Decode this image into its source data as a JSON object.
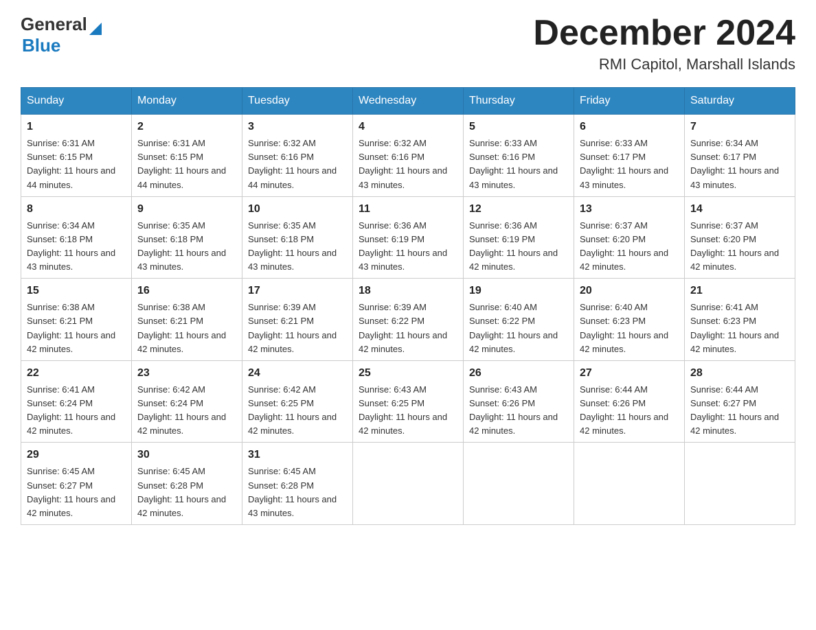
{
  "header": {
    "logo_general": "General",
    "logo_blue": "Blue",
    "month_title": "December 2024",
    "location": "RMI Capitol, Marshall Islands"
  },
  "days_of_week": [
    "Sunday",
    "Monday",
    "Tuesday",
    "Wednesday",
    "Thursday",
    "Friday",
    "Saturday"
  ],
  "weeks": [
    [
      {
        "day": "1",
        "sunrise": "6:31 AM",
        "sunset": "6:15 PM",
        "daylight": "11 hours and 44 minutes."
      },
      {
        "day": "2",
        "sunrise": "6:31 AM",
        "sunset": "6:15 PM",
        "daylight": "11 hours and 44 minutes."
      },
      {
        "day": "3",
        "sunrise": "6:32 AM",
        "sunset": "6:16 PM",
        "daylight": "11 hours and 44 minutes."
      },
      {
        "day": "4",
        "sunrise": "6:32 AM",
        "sunset": "6:16 PM",
        "daylight": "11 hours and 43 minutes."
      },
      {
        "day": "5",
        "sunrise": "6:33 AM",
        "sunset": "6:16 PM",
        "daylight": "11 hours and 43 minutes."
      },
      {
        "day": "6",
        "sunrise": "6:33 AM",
        "sunset": "6:17 PM",
        "daylight": "11 hours and 43 minutes."
      },
      {
        "day": "7",
        "sunrise": "6:34 AM",
        "sunset": "6:17 PM",
        "daylight": "11 hours and 43 minutes."
      }
    ],
    [
      {
        "day": "8",
        "sunrise": "6:34 AM",
        "sunset": "6:18 PM",
        "daylight": "11 hours and 43 minutes."
      },
      {
        "day": "9",
        "sunrise": "6:35 AM",
        "sunset": "6:18 PM",
        "daylight": "11 hours and 43 minutes."
      },
      {
        "day": "10",
        "sunrise": "6:35 AM",
        "sunset": "6:18 PM",
        "daylight": "11 hours and 43 minutes."
      },
      {
        "day": "11",
        "sunrise": "6:36 AM",
        "sunset": "6:19 PM",
        "daylight": "11 hours and 43 minutes."
      },
      {
        "day": "12",
        "sunrise": "6:36 AM",
        "sunset": "6:19 PM",
        "daylight": "11 hours and 42 minutes."
      },
      {
        "day": "13",
        "sunrise": "6:37 AM",
        "sunset": "6:20 PM",
        "daylight": "11 hours and 42 minutes."
      },
      {
        "day": "14",
        "sunrise": "6:37 AM",
        "sunset": "6:20 PM",
        "daylight": "11 hours and 42 minutes."
      }
    ],
    [
      {
        "day": "15",
        "sunrise": "6:38 AM",
        "sunset": "6:21 PM",
        "daylight": "11 hours and 42 minutes."
      },
      {
        "day": "16",
        "sunrise": "6:38 AM",
        "sunset": "6:21 PM",
        "daylight": "11 hours and 42 minutes."
      },
      {
        "day": "17",
        "sunrise": "6:39 AM",
        "sunset": "6:21 PM",
        "daylight": "11 hours and 42 minutes."
      },
      {
        "day": "18",
        "sunrise": "6:39 AM",
        "sunset": "6:22 PM",
        "daylight": "11 hours and 42 minutes."
      },
      {
        "day": "19",
        "sunrise": "6:40 AM",
        "sunset": "6:22 PM",
        "daylight": "11 hours and 42 minutes."
      },
      {
        "day": "20",
        "sunrise": "6:40 AM",
        "sunset": "6:23 PM",
        "daylight": "11 hours and 42 minutes."
      },
      {
        "day": "21",
        "sunrise": "6:41 AM",
        "sunset": "6:23 PM",
        "daylight": "11 hours and 42 minutes."
      }
    ],
    [
      {
        "day": "22",
        "sunrise": "6:41 AM",
        "sunset": "6:24 PM",
        "daylight": "11 hours and 42 minutes."
      },
      {
        "day": "23",
        "sunrise": "6:42 AM",
        "sunset": "6:24 PM",
        "daylight": "11 hours and 42 minutes."
      },
      {
        "day": "24",
        "sunrise": "6:42 AM",
        "sunset": "6:25 PM",
        "daylight": "11 hours and 42 minutes."
      },
      {
        "day": "25",
        "sunrise": "6:43 AM",
        "sunset": "6:25 PM",
        "daylight": "11 hours and 42 minutes."
      },
      {
        "day": "26",
        "sunrise": "6:43 AM",
        "sunset": "6:26 PM",
        "daylight": "11 hours and 42 minutes."
      },
      {
        "day": "27",
        "sunrise": "6:44 AM",
        "sunset": "6:26 PM",
        "daylight": "11 hours and 42 minutes."
      },
      {
        "day": "28",
        "sunrise": "6:44 AM",
        "sunset": "6:27 PM",
        "daylight": "11 hours and 42 minutes."
      }
    ],
    [
      {
        "day": "29",
        "sunrise": "6:45 AM",
        "sunset": "6:27 PM",
        "daylight": "11 hours and 42 minutes."
      },
      {
        "day": "30",
        "sunrise": "6:45 AM",
        "sunset": "6:28 PM",
        "daylight": "11 hours and 42 minutes."
      },
      {
        "day": "31",
        "sunrise": "6:45 AM",
        "sunset": "6:28 PM",
        "daylight": "11 hours and 43 minutes."
      },
      null,
      null,
      null,
      null
    ]
  ]
}
